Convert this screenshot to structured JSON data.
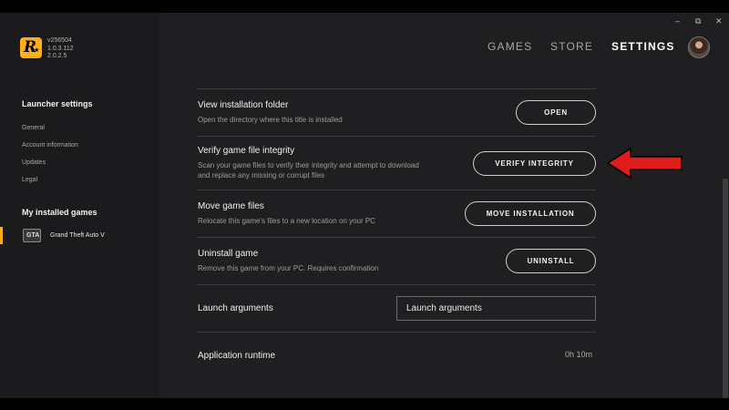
{
  "app": {
    "version_lines": [
      "v256504",
      "1.0.3.112",
      "2.0.2.5"
    ]
  },
  "window_controls": {
    "minimize": "–",
    "restore": "⧉",
    "close": "✕"
  },
  "nav": {
    "games": "GAMES",
    "store": "STORE",
    "settings": "SETTINGS",
    "active": "settings"
  },
  "sidebar": {
    "launcher_heading": "Launcher settings",
    "links": [
      "General",
      "Account information",
      "Updates",
      "Legal"
    ],
    "installed_heading": "My installed games",
    "game_name": "Grand Theft Auto V",
    "game_icon_text": "GTA"
  },
  "settings": {
    "view_folder": {
      "title": "View installation folder",
      "desc": "Open the directory where this title is installed",
      "button": "OPEN"
    },
    "verify": {
      "title": "Verify game file integrity",
      "desc_line1": "Scan your game files to verify their integrity and attempt to download",
      "desc_line2": "and replace any missing or corrupt files",
      "button": "VERIFY INTEGRITY"
    },
    "move": {
      "title": "Move game files",
      "desc": "Relocate this game's files to a new location on your PC",
      "button": "MOVE INSTALLATION"
    },
    "uninstall": {
      "title": "Uninstall game",
      "desc": "Remove this game from your PC. Requires confirmation",
      "button": "UNINSTALL"
    },
    "launch_args": {
      "title": "Launch arguments",
      "value": "Launch arguments"
    },
    "runtime": {
      "title": "Application runtime",
      "value": "0h 10m"
    }
  },
  "colors": {
    "brand": "#fcaf17",
    "annotation_arrow": "#e01b1b"
  }
}
